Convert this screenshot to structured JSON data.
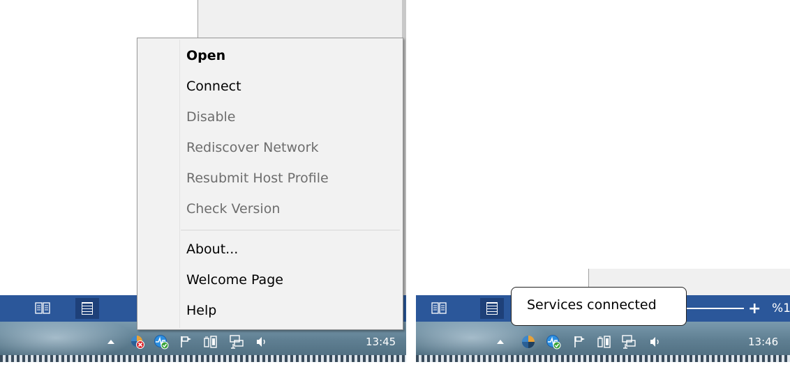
{
  "context_menu": {
    "items": [
      {
        "label": "Open",
        "style": "bold",
        "enabled": true
      },
      {
        "label": "Connect",
        "style": "normal",
        "enabled": true
      },
      {
        "label": "Disable",
        "style": "normal",
        "enabled": false
      },
      {
        "label": "Rediscover Network",
        "style": "normal",
        "enabled": false
      },
      {
        "label": "Resubmit Host Profile",
        "style": "normal",
        "enabled": false
      },
      {
        "label": "Check Version",
        "style": "normal",
        "enabled": false
      },
      {
        "label": "About...",
        "style": "normal",
        "enabled": true
      },
      {
        "label": "Welcome Page",
        "style": "normal",
        "enabled": true
      },
      {
        "label": "Help",
        "style": "normal",
        "enabled": true
      }
    ]
  },
  "left_taskbar": {
    "clock": "13:45",
    "tray_icons": [
      "show-hidden-icons-arrow",
      "agent-disconnected-icon",
      "network-monitor-icon",
      "action-center-flag-icon",
      "power-icon",
      "network-icon",
      "volume-icon"
    ]
  },
  "right_taskbar": {
    "clock": "13:46",
    "tray_icons": [
      "show-hidden-icons-arrow",
      "agent-connected-icon",
      "network-monitor-icon",
      "action-center-flag-icon",
      "power-icon",
      "network-icon",
      "volume-icon"
    ],
    "zoom_plus": "+",
    "zoom_text": "%1"
  },
  "balloon": {
    "text": "Services connected"
  },
  "colors": {
    "word_blue": "#2b579a",
    "menu_bg": "#f2f2f2",
    "disabled_text": "#6d6d6d"
  }
}
